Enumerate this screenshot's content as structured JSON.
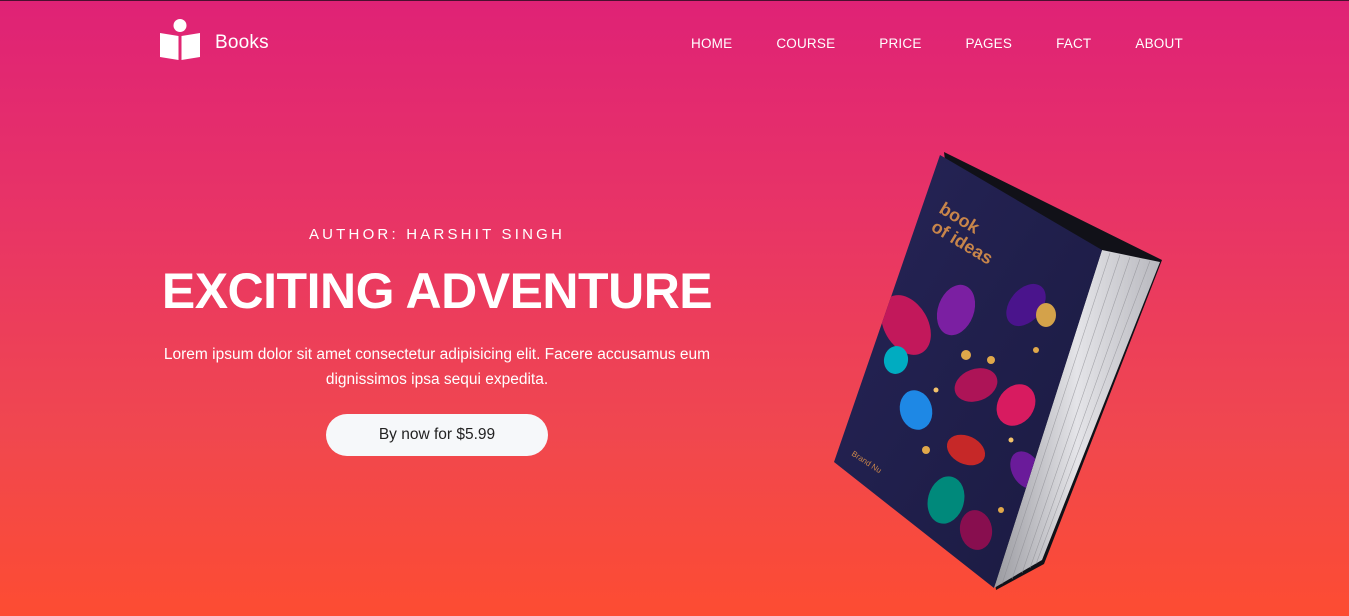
{
  "brand": {
    "name": "Books",
    "logo_icon": "reading-person-icon"
  },
  "nav": {
    "items": [
      {
        "label": "HOME"
      },
      {
        "label": "COURSE"
      },
      {
        "label": "PRICE"
      },
      {
        "label": "PAGES"
      },
      {
        "label": "FACT"
      },
      {
        "label": "ABOUT"
      }
    ]
  },
  "hero": {
    "author": "AUTHOR: HARSHIT SINGH",
    "title": "EXCITING ADVENTURE",
    "description": "Lorem ipsum dolor sit amet consectetur adipisicing elit. Facere accusamus eum dignissimos ipsa sequi expedita.",
    "cta_label": "By now for $5.99"
  },
  "book": {
    "cover_title_line1": "book",
    "cover_title_line2": "of ideas",
    "publisher": "Brand Nu"
  },
  "colors": {
    "gradient_top": "#df2276",
    "gradient_bottom": "#fd4c32",
    "button_bg": "#f6f8fa",
    "book_cover": "#232050",
    "cover_title": "#c8854a"
  }
}
